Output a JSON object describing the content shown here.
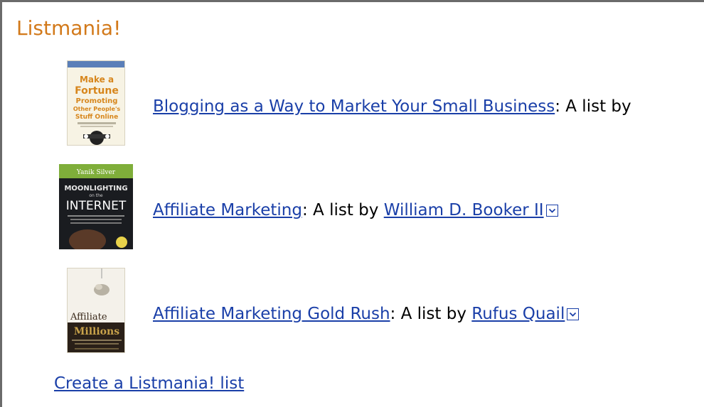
{
  "listmania": {
    "title": "Listmania!",
    "by_text": ": A list by",
    "by_text_cut": ": A list by",
    "items": [
      {
        "list_title": "Blogging as a Way to Market Your Small Business",
        "author": "",
        "cover": {
          "lines": [
            "Make a",
            "Fortune",
            "Promoting",
            "Other People's",
            "Stuff Online"
          ],
          "colors": {
            "bg": "#f7f3e4",
            "title": "#d7861c",
            "band": "#5b7fb8"
          }
        }
      },
      {
        "list_title": "Affiliate Marketing",
        "author": "William D. Booker II",
        "cover": {
          "lines": [
            "Yanik Silver",
            "MOONLIGHTING",
            "on the",
            "INTERNET"
          ],
          "colors": {
            "top": "#7fae3a",
            "bg": "#1a1c20",
            "text": "#ffffff",
            "accent": "#e8d24a"
          }
        }
      },
      {
        "list_title": "Affiliate Marketing Gold Rush",
        "author": "Rufus Quail",
        "cover": {
          "lines": [
            "Affiliate",
            "Millions"
          ],
          "colors": {
            "bg": "#f4f1ea",
            "dark": "#3a2a1c",
            "gold": "#c8a24a"
          }
        }
      }
    ],
    "create_link": "Create a Listmania! list"
  },
  "colors": {
    "heading": "#d2791a",
    "link": "#1a3fa8",
    "border": "#6b6b6b"
  },
  "icons": {
    "dropdown": "chevron-down-box-icon"
  }
}
